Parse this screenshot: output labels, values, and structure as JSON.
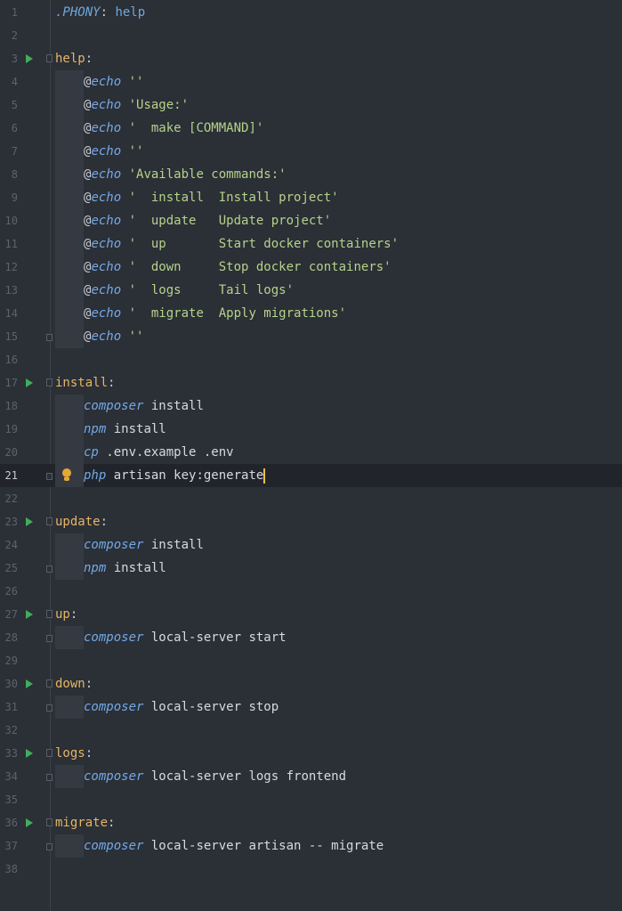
{
  "editor": {
    "current_line": 21,
    "lines": [
      {
        "n": "1",
        "phony": ".PHONY",
        "rest": "help"
      },
      {
        "n": "2"
      },
      {
        "n": "3",
        "label": "help"
      },
      {
        "n": "4",
        "cmd": "@echo",
        "arg": "''"
      },
      {
        "n": "5",
        "cmd": "@echo",
        "arg": "'Usage:'"
      },
      {
        "n": "6",
        "cmd": "@echo",
        "arg": "'  make [COMMAND]'"
      },
      {
        "n": "7",
        "cmd": "@echo",
        "arg": "''"
      },
      {
        "n": "8",
        "cmd": "@echo",
        "arg": "'Available commands:'"
      },
      {
        "n": "9",
        "cmd": "@echo",
        "arg": "'  install  Install project'"
      },
      {
        "n": "10",
        "cmd": "@echo",
        "arg": "'  update   Update project'"
      },
      {
        "n": "11",
        "cmd": "@echo",
        "arg": "'  up       Start docker containers'"
      },
      {
        "n": "12",
        "cmd": "@echo",
        "arg": "'  down     Stop docker containers'"
      },
      {
        "n": "13",
        "cmd": "@echo",
        "arg": "'  logs     Tail logs'"
      },
      {
        "n": "14",
        "cmd": "@echo",
        "arg": "'  migrate  Apply migrations'"
      },
      {
        "n": "15",
        "cmd": "@echo",
        "arg": "''"
      },
      {
        "n": "16"
      },
      {
        "n": "17",
        "label": "install"
      },
      {
        "n": "18",
        "cmd": "composer",
        "arg": "install"
      },
      {
        "n": "19",
        "cmd": "npm",
        "arg": "install"
      },
      {
        "n": "20",
        "cmd": "cp",
        "arg": ".env.example .env"
      },
      {
        "n": "21",
        "cmd": "php",
        "arg": "artisan key:generate"
      },
      {
        "n": "22"
      },
      {
        "n": "23",
        "label": "update"
      },
      {
        "n": "24",
        "cmd": "composer",
        "arg": "install"
      },
      {
        "n": "25",
        "cmd": "npm",
        "arg": "install"
      },
      {
        "n": "26"
      },
      {
        "n": "27",
        "label": "up"
      },
      {
        "n": "28",
        "cmd": "composer",
        "arg": "local-server start"
      },
      {
        "n": "29"
      },
      {
        "n": "30",
        "label": "down"
      },
      {
        "n": "31",
        "cmd": "composer",
        "arg": "local-server stop"
      },
      {
        "n": "32"
      },
      {
        "n": "33",
        "label": "logs"
      },
      {
        "n": "34",
        "cmd": "composer",
        "arg": "local-server logs frontend"
      },
      {
        "n": "35"
      },
      {
        "n": "36",
        "label": "migrate"
      },
      {
        "n": "37",
        "cmd": "composer",
        "arg": "local-server artisan -- migrate"
      },
      {
        "n": "38"
      }
    ]
  }
}
